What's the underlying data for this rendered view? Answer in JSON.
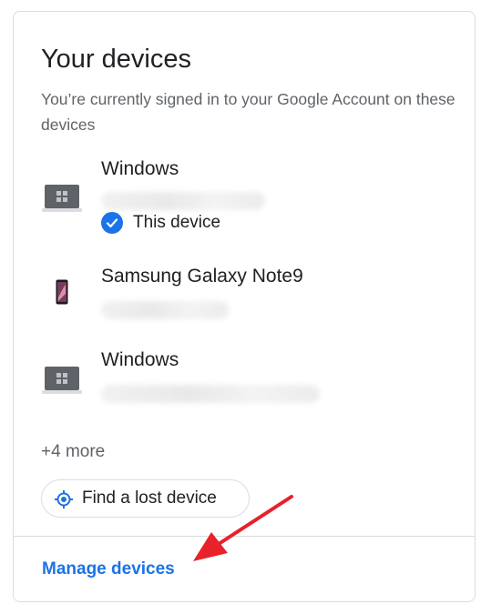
{
  "card": {
    "title": "Your devices",
    "subtitle": "You’re currently signed in to your Google Account on these devices"
  },
  "devices": [
    {
      "name": "Windows",
      "icon": "laptop-windows-icon",
      "this_device_label": "This device"
    },
    {
      "name": "Samsung Galaxy Note9",
      "icon": "phone-icon"
    },
    {
      "name": "Windows",
      "icon": "laptop-windows-icon"
    }
  ],
  "more_label": "+4 more",
  "find_button": {
    "label": "Find a lost device",
    "icon": "location-target-icon"
  },
  "manage_link": {
    "label": "Manage devices"
  },
  "colors": {
    "accent": "#1a73e8",
    "annotation_arrow": "#e8212b",
    "text_primary": "#202124",
    "text_secondary": "#5f6368",
    "border": "#dadce0"
  }
}
